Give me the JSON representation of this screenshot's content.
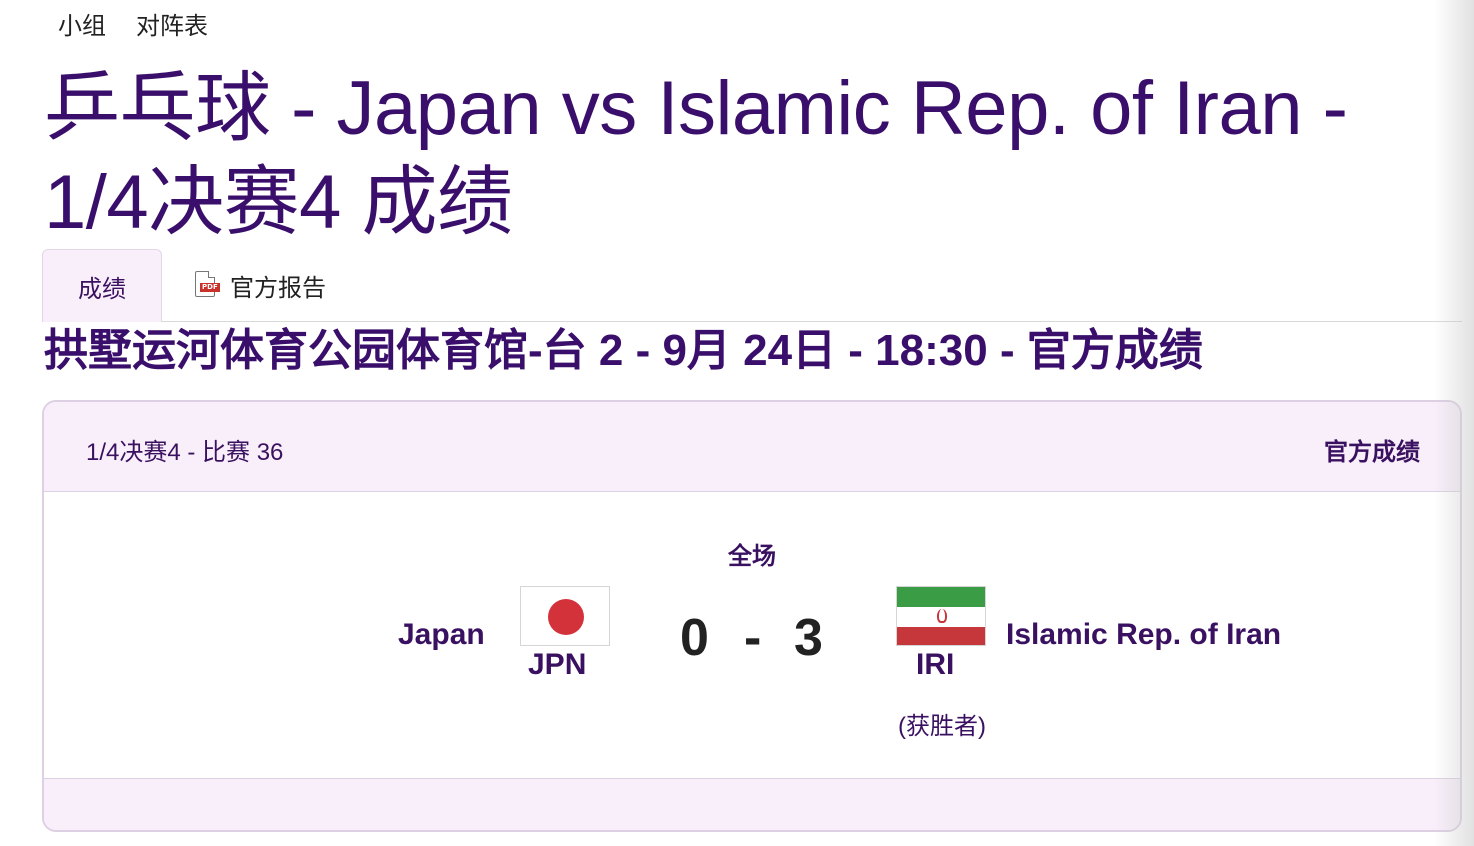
{
  "nav": {
    "item1": "小组",
    "item2": "对阵表"
  },
  "title": "乒乓球 - Japan vs Islamic Rep. of Iran - 1/4决赛4 成绩",
  "tabs": {
    "results": "成绩",
    "report": "官方报告",
    "report_icon": "pdf-icon"
  },
  "venue_line": "拱墅运河体育公园体育馆-台 2 - 9月 24日 - 18:30 - 官方成绩",
  "match": {
    "phase": "1/4决赛4  - 比赛 36",
    "status": "官方成绩",
    "period": "全场",
    "home": {
      "name": "Japan",
      "code": "JPN",
      "score": "0"
    },
    "away": {
      "name": "Islamic Rep. of Iran",
      "code": "IRI",
      "score": "3",
      "winner": "(获胜者)"
    },
    "separator": "-"
  },
  "colors": {
    "brand": "#3a0f6b",
    "tint": "#f8effa",
    "jpn_red": "#d4323b",
    "iri_green": "#3a9d45",
    "iri_red": "#c6373c"
  }
}
